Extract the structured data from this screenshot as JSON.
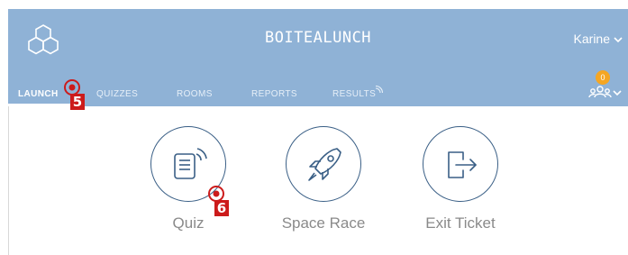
{
  "header": {
    "app_title": "BOITEALUNCH",
    "user_name": "Karine",
    "logo_icon": "hexagon-molecule-icon",
    "class_count": "0",
    "class_icon": "group-people-icon"
  },
  "nav": {
    "items": [
      {
        "label": "LAUNCH",
        "active": true
      },
      {
        "label": "QUIZZES",
        "active": false
      },
      {
        "label": "ROOMS",
        "active": false
      },
      {
        "label": "REPORTS",
        "active": false
      },
      {
        "label": "RESULTS",
        "active": false
      }
    ]
  },
  "launch_options": [
    {
      "label": "Quiz",
      "icon": "quiz-document-signal-icon"
    },
    {
      "label": "Space Race",
      "icon": "rocket-icon"
    },
    {
      "label": "Exit Ticket",
      "icon": "exit-door-arrow-icon"
    }
  ],
  "step_markers": [
    {
      "number": "5",
      "target": "nav-launch"
    },
    {
      "number": "6",
      "target": "quiz-tile"
    }
  ],
  "colors": {
    "header_bg": "#8fb2d6",
    "icon_stroke": "#3a5f86",
    "label_gray": "#8a8a8a",
    "badge": "#f5a623",
    "marker_red": "#cc1b1b"
  }
}
